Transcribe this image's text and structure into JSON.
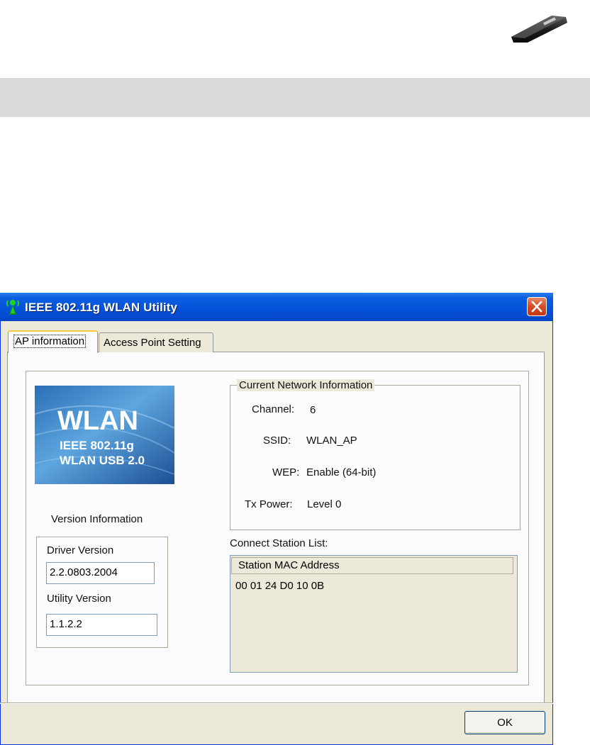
{
  "window": {
    "title": "IEEE 802.11g WLAN Utility",
    "titlebar_color": "#0551d8"
  },
  "tabs": [
    {
      "label": "AP information",
      "selected": true
    },
    {
      "label": "Access Point Setting",
      "selected": false
    }
  ],
  "logo": {
    "big_text": "WLAN",
    "line1": "IEEE 802.11g",
    "line2": "WLAN USB 2.0"
  },
  "version": {
    "heading": "Version Information",
    "driver_label": "Driver Version",
    "driver_value": "2.2.0803.2004",
    "utility_label": "Utility Version",
    "utility_value": "1.1.2.2"
  },
  "network": {
    "legend": "Current Network Information",
    "channel_label": "Channel:",
    "channel_value": "6",
    "ssid_label": "SSID:",
    "ssid_value": "WLAN_AP",
    "wep_label": "WEP:",
    "wep_value": "Enable (64-bit)",
    "txpower_label": "Tx Power:",
    "txpower_value": "Level 0"
  },
  "stations": {
    "label": "Connect Station List:",
    "column_header": "Station MAC Address",
    "rows": [
      "00 01 24 D0 10 0B"
    ]
  },
  "buttons": {
    "ok": "OK"
  },
  "icons": {
    "title_icon": "antenna-icon",
    "close_icon": "close-icon",
    "header_image": "usb-stick-icon"
  }
}
